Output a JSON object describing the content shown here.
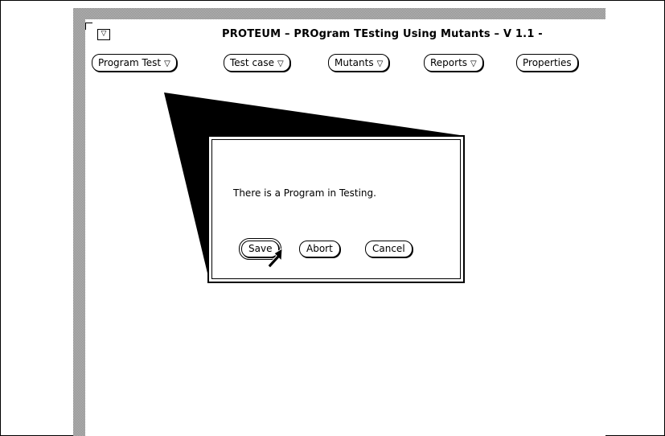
{
  "window": {
    "title": "PROTEUM – PROgram TEsting Using Mutants – V 1.1 -",
    "menu_button_glyph": "▽"
  },
  "menubar": {
    "items": [
      {
        "label": "Program Test",
        "has_menu": true
      },
      {
        "label": "Test case",
        "has_menu": true
      },
      {
        "label": "Mutants",
        "has_menu": true
      },
      {
        "label": "Reports",
        "has_menu": true
      },
      {
        "label": "Properties",
        "has_menu": false
      }
    ],
    "menu_glyph": "▽"
  },
  "dialog": {
    "message": "There is a Program in Testing.",
    "buttons": {
      "save": "Save",
      "abort": "Abort",
      "cancel": "Cancel"
    }
  },
  "colors": {
    "background": "#ffffff",
    "foreground": "#000000",
    "stipple": "#9a9a9a"
  }
}
